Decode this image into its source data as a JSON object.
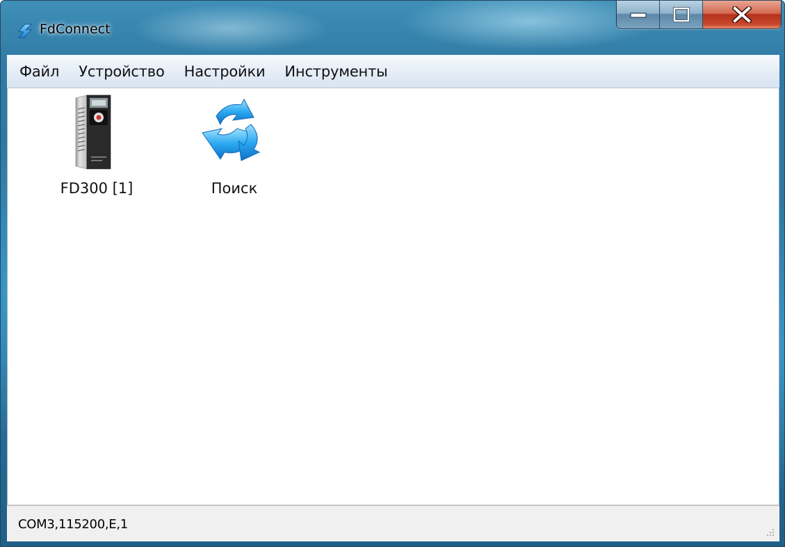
{
  "window": {
    "title": "FdConnect",
    "app_icon": "fdconnect-logo-icon",
    "controls": {
      "minimize_icon": "minimize-icon",
      "maximize_icon": "maximize-icon",
      "close_icon": "close-icon"
    }
  },
  "menubar": {
    "items": [
      {
        "label": "Файл"
      },
      {
        "label": "Устройство"
      },
      {
        "label": "Настройки"
      },
      {
        "label": "Инструменты"
      }
    ]
  },
  "main": {
    "tiles": [
      {
        "label": "FD300 [1]",
        "icon": "frequency-drive-icon"
      },
      {
        "label": "Поиск",
        "icon": "refresh-search-icon"
      }
    ]
  },
  "statusbar": {
    "text": "COM3,115200,E,1",
    "grip_icon": "resize-grip-icon"
  },
  "colors": {
    "title_glass": "#2f7aa4",
    "close_button": "#c9472c",
    "accent_blue": "#1e90e0"
  }
}
